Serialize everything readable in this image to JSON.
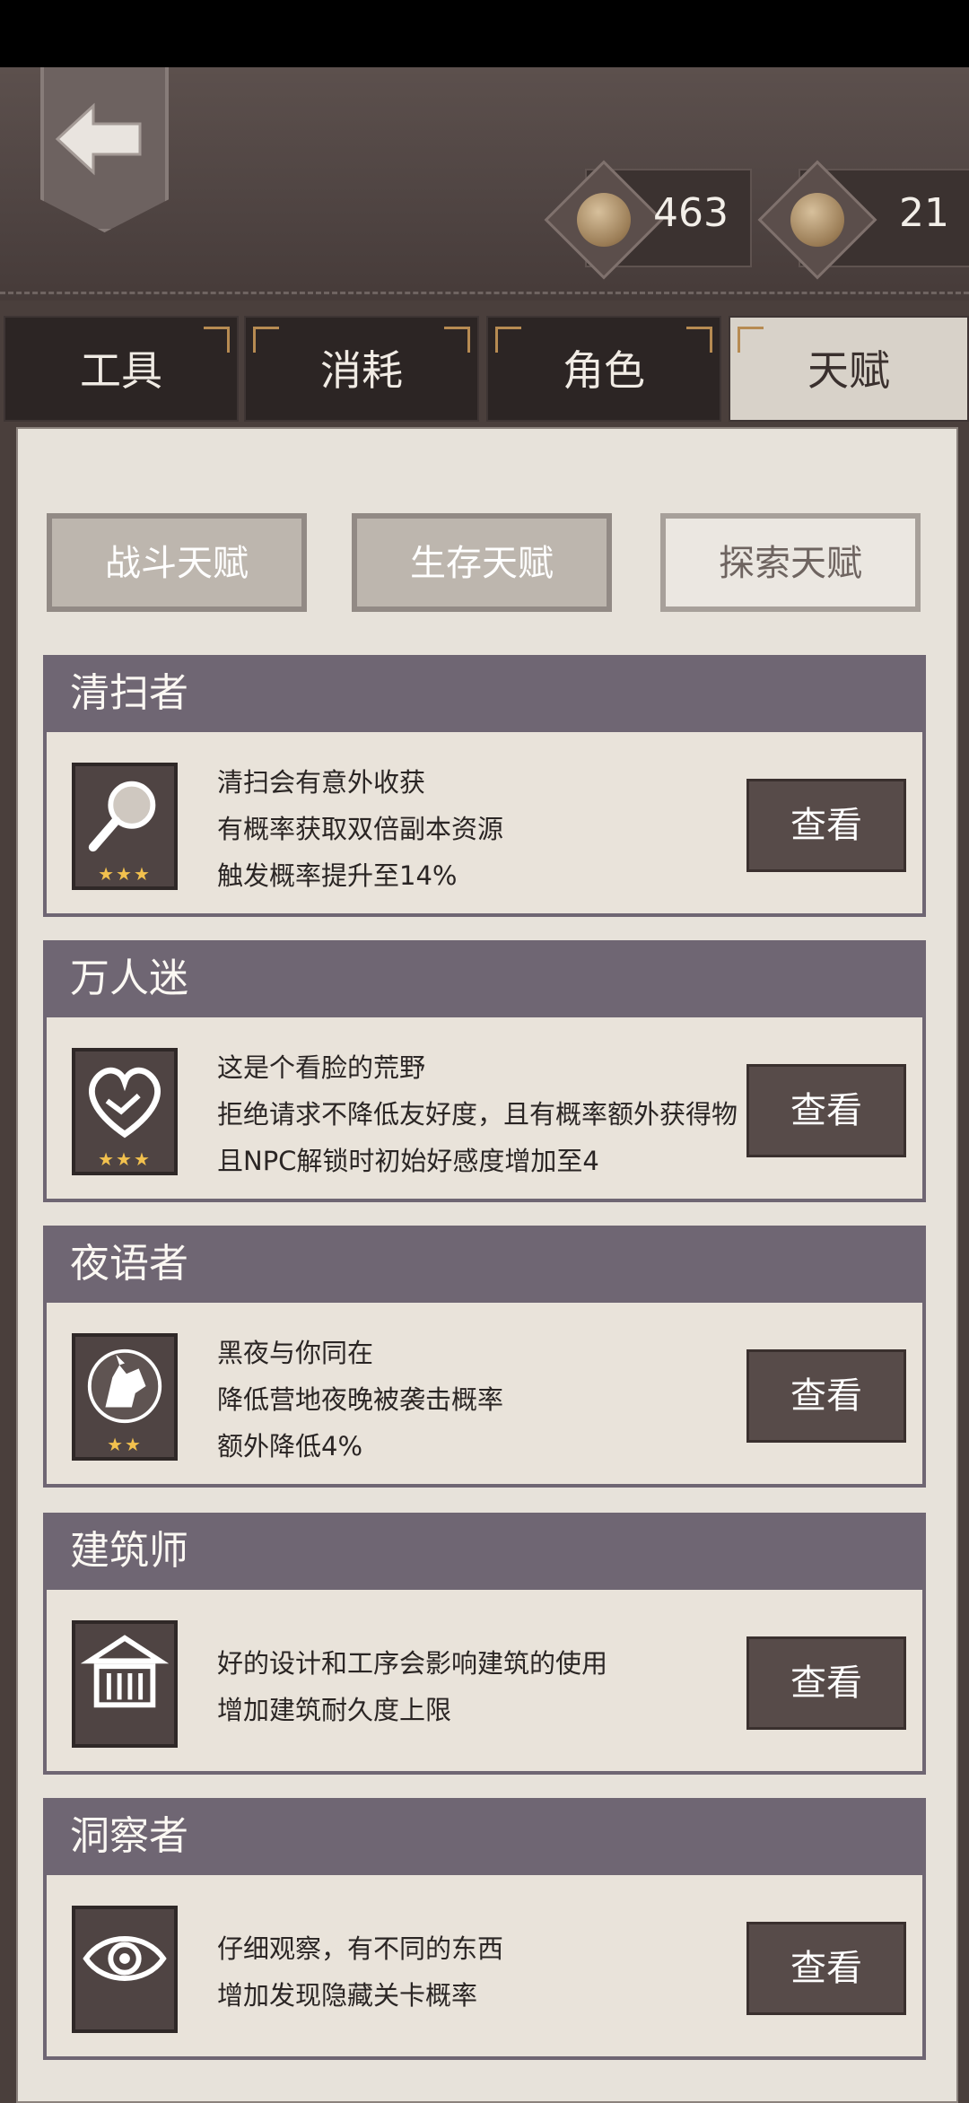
{
  "currency": [
    {
      "icon": "coin-icon",
      "value": "463"
    },
    {
      "icon": "coin-icon",
      "value": "21"
    }
  ],
  "tabs": [
    "工具",
    "消耗",
    "角色",
    "天赋"
  ],
  "active_tab": "天赋",
  "subtabs": [
    "战斗天赋",
    "生存天赋",
    "探索天赋"
  ],
  "active_subtab": "探索天赋",
  "talents": [
    {
      "title": "清扫者",
      "icon": "magnifier-icon",
      "stars": "★★★",
      "lines": [
        "清扫会有意外收获",
        "有概率获取双倍副本资源",
        "触发概率提升至14%"
      ],
      "button": "查看"
    },
    {
      "title": "万人迷",
      "icon": "heart-handshake-icon",
      "stars": "★★★",
      "lines": [
        "这是个看脸的荒野",
        "拒绝请求不降低友好度，且有概率额外获得物",
        "且NPC解锁时初始好感度增加至4"
      ],
      "button": "查看"
    },
    {
      "title": "夜语者",
      "icon": "wolf-icon",
      "stars": "★★",
      "lines": [
        "黑夜与你同在",
        "降低营地夜晚被袭击概率",
        "额外降低4%"
      ],
      "button": "查看"
    },
    {
      "title": "建筑师",
      "icon": "building-icon",
      "stars": "",
      "lines": [
        "好的设计和工序会影响建筑的使用",
        "增加建筑耐久度上限"
      ],
      "button": "查看"
    },
    {
      "title": "洞察者",
      "icon": "eye-icon",
      "stars": "",
      "lines": [
        "仔细观察，有不同的东西",
        "增加发现隐藏关卡概率"
      ],
      "button": "查看"
    }
  ]
}
